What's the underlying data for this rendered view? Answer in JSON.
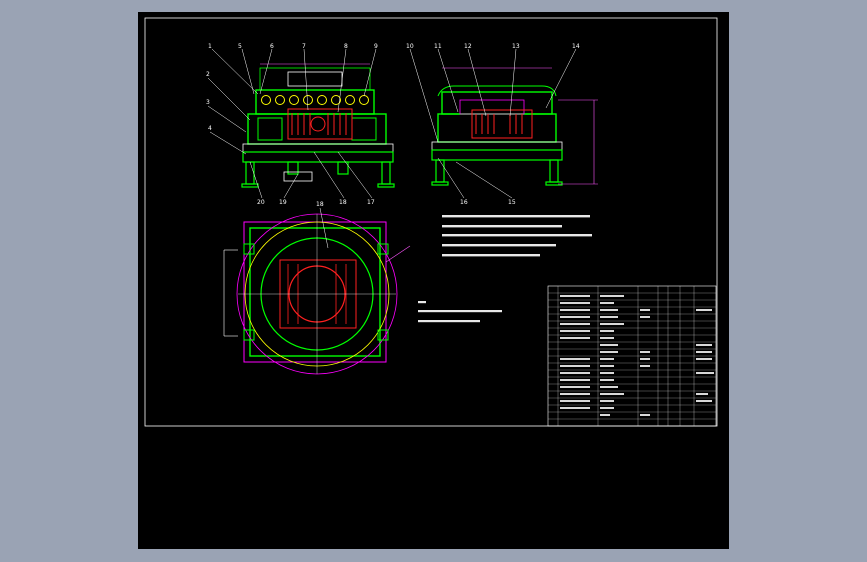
{
  "colors": {
    "background": "#9aa3b4",
    "paper": "#000000",
    "border": "#ffffff",
    "frame_green": "#00ff00",
    "motor_red": "#ff2020",
    "frame_magenta": "#ff00ff",
    "leader_white": "#ffffff",
    "dim_magenta": "#ff55ff",
    "guide_yellow": "#ffff00",
    "table_blue": "#3a6bff"
  },
  "front_view": {
    "balloons": [
      "1",
      "2",
      "3",
      "4",
      "5",
      "6",
      "7",
      "8",
      "9",
      "20",
      "19",
      "18",
      "17"
    ]
  },
  "side_view": {
    "balloons": [
      "10",
      "11",
      "12",
      "13",
      "14",
      "16",
      "15"
    ]
  },
  "top_view": {
    "balloons": [
      "18"
    ]
  },
  "icons": [
    "callout-balloon-icon",
    "dimension-arrow-icon"
  ]
}
